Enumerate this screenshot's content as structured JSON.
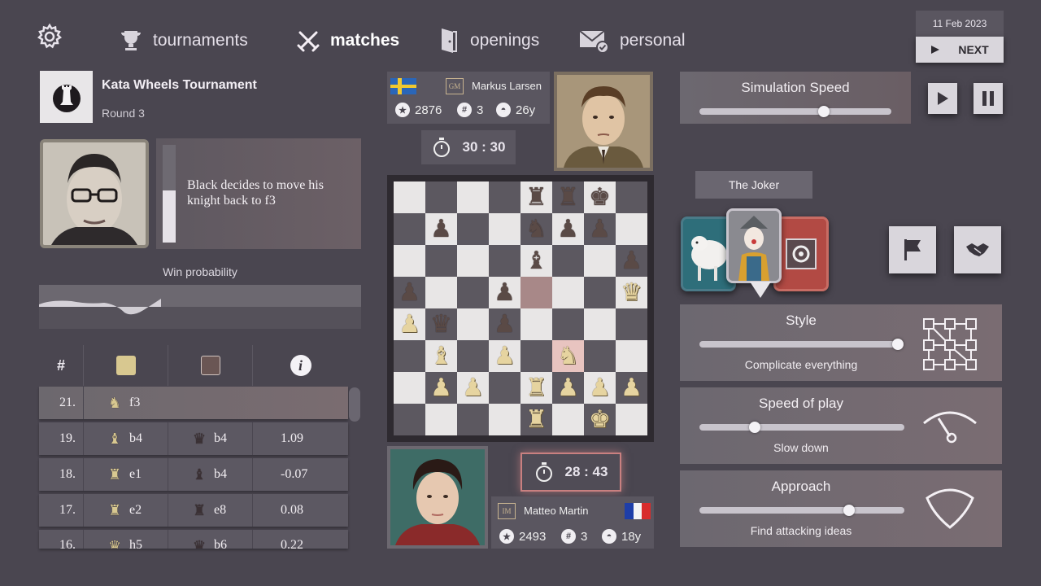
{
  "nav": {
    "items": [
      {
        "label": "tournaments",
        "icon": "trophy-icon"
      },
      {
        "label": "matches",
        "icon": "crossed-swords-icon"
      },
      {
        "label": "openings",
        "icon": "door-icon"
      },
      {
        "label": "personal",
        "icon": "mail-check-icon"
      }
    ],
    "active": "matches",
    "date": "11 Feb 2023",
    "next_label": "NEXT"
  },
  "tournament": {
    "name": "Kata Wheels Tournament",
    "round": "Round 3"
  },
  "commentary": {
    "text": "Black decides to move his knight back to f3",
    "bar_fill": 0.53
  },
  "win_probability": {
    "label": "Win probability"
  },
  "moves_table": {
    "headers": {
      "num": "#"
    },
    "colors": {
      "white": "#d8c890",
      "black": "#6a5654"
    },
    "rows": [
      {
        "num": "21.",
        "white_piece": "♞",
        "white_move": "f3",
        "black_piece": "",
        "black_move": "",
        "eval": ""
      },
      {
        "num": "19.",
        "white_piece": "♝",
        "white_move": "b4",
        "black_piece": "♛",
        "black_move": "b4",
        "eval": "1.09"
      },
      {
        "num": "18.",
        "white_piece": "♜",
        "white_move": "e1",
        "black_piece": "♝",
        "black_move": "b4",
        "eval": "-0.07"
      },
      {
        "num": "17.",
        "white_piece": "♜",
        "white_move": "e2",
        "black_piece": "♜",
        "black_move": "e8",
        "eval": "0.08"
      },
      {
        "num": "16.",
        "white_piece": "♛",
        "white_move": "h5",
        "black_piece": "♛",
        "black_move": "b6",
        "eval": "0.22"
      }
    ]
  },
  "black_player": {
    "name": "Markus Larsen",
    "title": "GM",
    "rating": "2876",
    "rank": "3",
    "age": "26y",
    "clock": "30 : 30"
  },
  "white_player": {
    "name": "Matteo Martin",
    "title": "IM",
    "rating": "2493",
    "rank": "3",
    "age": "18y",
    "clock": "28 : 43"
  },
  "board": {
    "rows": [
      [
        "",
        "",
        "",
        "",
        "br",
        "br",
        "bk",
        ""
      ],
      [
        "",
        "bp",
        "",
        "",
        "bn",
        "bp",
        "bp",
        ""
      ],
      [
        "",
        "",
        "",
        "",
        "bb",
        "",
        "",
        "bp"
      ],
      [
        "bp",
        "",
        "",
        "bp",
        "",
        "",
        "",
        "wq"
      ],
      [
        "wp",
        "bq",
        "",
        "bp",
        "",
        "",
        "",
        ""
      ],
      [
        "",
        "wb",
        "",
        "wp",
        "",
        "wn",
        "",
        ""
      ],
      [
        "",
        "wp",
        "wp",
        "",
        "wr",
        "wp",
        "wp",
        "wp"
      ],
      [
        "",
        "",
        "",
        "",
        "wr",
        "",
        "wk",
        ""
      ]
    ],
    "highlights": [
      [
        3,
        4
      ],
      [
        5,
        5
      ]
    ]
  },
  "simulation": {
    "label": "Simulation Speed",
    "value": 0.65
  },
  "joker": {
    "label": "The Joker"
  },
  "style": {
    "title": "Style",
    "subtitle": "Complicate everything",
    "value": 1.0
  },
  "speed_of_play": {
    "title": "Speed of play",
    "subtitle": "Slow down",
    "value": 0.27
  },
  "approach": {
    "title": "Approach",
    "subtitle": "Find attacking ideas",
    "value": 0.73
  }
}
